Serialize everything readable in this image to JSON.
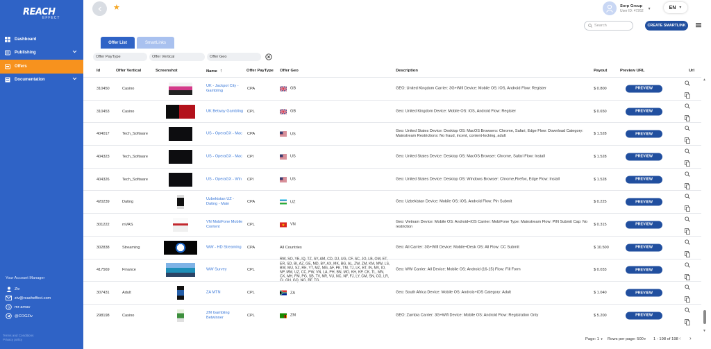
{
  "brand": {
    "logo_main": "REACH",
    "logo_sub": "EFFECT"
  },
  "sidebar": {
    "items": [
      {
        "label": "Dashboard",
        "icon": "dashboard-icon"
      },
      {
        "label": "Publishing",
        "icon": "publishing-icon",
        "chevron": true
      },
      {
        "label": "Offers",
        "icon": "offers-icon",
        "active": true
      },
      {
        "label": "Documentation",
        "icon": "documentation-icon",
        "chevron": true
      }
    ],
    "account_manager": {
      "title": "Your Account Manager",
      "name": "Ziv",
      "email": "ziv@reacheffect.com",
      "skype": "mr-arnav",
      "telegram": "@COGZiv"
    },
    "footer_links": [
      "Terms and Conditions",
      "Privacy policy"
    ]
  },
  "header": {
    "user_name": "Sorp Group",
    "user_id": "User ID: 47262",
    "language": "EN",
    "search_placeholder": "Search",
    "create_button": "CREATE SMARTLINK"
  },
  "tabs": [
    {
      "label": "Offer List",
      "active": true
    },
    {
      "label": "SmartLinks",
      "active": false
    }
  ],
  "filters": {
    "paytype": "Offer PayType",
    "vertical": "Offer Vertical",
    "geo": "Offer Geo"
  },
  "table": {
    "columns": {
      "id": "Id",
      "vertical": "Offer Vertical",
      "screenshot": "Screenshot",
      "name": "Name",
      "paytype": "Offer PayType",
      "geo": "Offer Geo",
      "description": "Description",
      "payout": "Payout",
      "preview": "Preview URL",
      "url": "Url"
    },
    "preview_label": "PREVIEW",
    "rows": [
      {
        "id": "310450",
        "vertical": "Casino",
        "name": "UK - Jackpot City - Gambling",
        "paytype": "CPA",
        "geo": "GB",
        "flag": "gb",
        "description": "GEO: United Kingdom Carrier: 3G+Wifi Device: Mobile OS: iOS, Android Flow: Register",
        "payout": "$ 0.800",
        "shot": "pink"
      },
      {
        "id": "310453",
        "vertical": "Casino",
        "name": "UK Betway Gambling",
        "paytype": "CPL",
        "geo": "GB",
        "flag": "gb",
        "description": "Geo: United Kingdom Device: Mobile OS: iOS, Android Flow: Register",
        "payout": "$ 0.650",
        "shot": "red"
      },
      {
        "id": "404017",
        "vertical": "Tech_Software",
        "name": "US - OperaGX - Mac",
        "paytype": "CPA",
        "geo": "US",
        "flag": "us",
        "description": "Geo: United States Device: Desktop OS: MacOS Browsers: Chrome, Safari, Edge Flow: Download Category: Mainstream Restrictions: No fraud, incent, content-locking, adult",
        "payout": "$ 1.528",
        "shot": "dark"
      },
      {
        "id": "404323",
        "vertical": "Tech_Software",
        "name": "US - OperaGX - Mac",
        "paytype": "CPI",
        "geo": "US",
        "flag": "us",
        "description": "Geo: United States Device: Desktop OS: MacOS Browser: Chrome, Safari Flow: Install",
        "payout": "$ 1.528",
        "shot": "dark"
      },
      {
        "id": "404326",
        "vertical": "Tech_Software",
        "name": "US - OperaGX - Win",
        "paytype": "CPI",
        "geo": "US",
        "flag": "us",
        "description": "Geo: United States Device: Desktop OS: Windows Browser: Chrome,Firefox, Edge Flow: Install",
        "payout": "$ 1.528",
        "shot": "dark"
      },
      {
        "id": "420239",
        "vertical": "Dating",
        "name": "Uzbekistan UZ - Dating - Main",
        "paytype": "CPA",
        "geo": "UZ",
        "flag": "uz",
        "description": "Geo: Uzbekistan Device: Mobile OS: iOS, Android Flow: Pin Submit",
        "payout": "$ 0.225",
        "shot": "phone"
      },
      {
        "id": "301222",
        "vertical": "mVAS",
        "name": "VN MobiFone Mobile Content",
        "paytype": "CPL",
        "geo": "VN",
        "flag": "vn",
        "description": "Geo: Vietnam Device: Mobile OS: Android+iOS Carrier: MobiFone Type: Mainstream Flow: PIN Submit Cap: No restriction",
        "payout": "$ 0.315",
        "shot": "light"
      },
      {
        "id": "302838",
        "vertical": "Streaming",
        "name": "WW - HD Streaming",
        "paytype": "CPA",
        "geo": "All Countries",
        "flag": "",
        "description": "Geo: All Carrier: 3G+Wifi Device: Mobile+Desk OS: All Flow: CC Submit",
        "payout": "$ 10.500",
        "shot": "stream"
      },
      {
        "id": "417569",
        "vertical": "Finance",
        "name": "WW Survey",
        "paytype": "CPL",
        "geo": "RW, SO, YE, IQ, TZ, SY, AM, CD, DJ, UG, CF, SC, JO, LB, OM, ET, ER, SD, BI, AZ, GE, MD, BY, AX, MK, BG, AL, ZW, ZM, KM, MW, LS, BW, MU, SZ, RE, YT, MZ, MG, AF, PK, TM, TJ, LK, BT, IN, MV, IO, NP, MM, UZ, CC, PW, VN, LA, PH, BN, MO, KH, KP, CK, TL, MN, CX, MH, FM, PG, SB, TV, NR, VU, NC, NF, FJ, LY, CM, SN, CG, LR, CI, GH, GQ, NG, BF, TG,",
        "flag": "",
        "multi": true,
        "description": "Geo: WW Carrier: All Device: Mobile OS: Android (16-15) Flow: Fill Form",
        "payout": "$ 0.033",
        "shot": "pool"
      },
      {
        "id": "307431",
        "vertical": "Adult",
        "name": "ZA MTN",
        "paytype": "CPL",
        "geo": "ZA",
        "flag": "za",
        "description": "Geo: South Africa Device: Mobile OS: Androis+iOS Category: Adult",
        "payout": "$ 1.040",
        "shot": "phone2"
      },
      {
        "id": "298198",
        "vertical": "Casino",
        "name": "ZM Gambling Betwinner",
        "paytype": "CPL",
        "geo": "ZM",
        "flag": "zm",
        "description": "GEO: Zambia Carrier: 3G+Wifi Device: Mobile OS: Android Flow: Registration Only",
        "payout": "$ 5.200",
        "shot": "green"
      }
    ]
  },
  "pager": {
    "page_label": "Page:",
    "page_value": "1",
    "rows_label": "Rows per page:",
    "rows_value": "500",
    "range": "1 - 198 of 198"
  }
}
